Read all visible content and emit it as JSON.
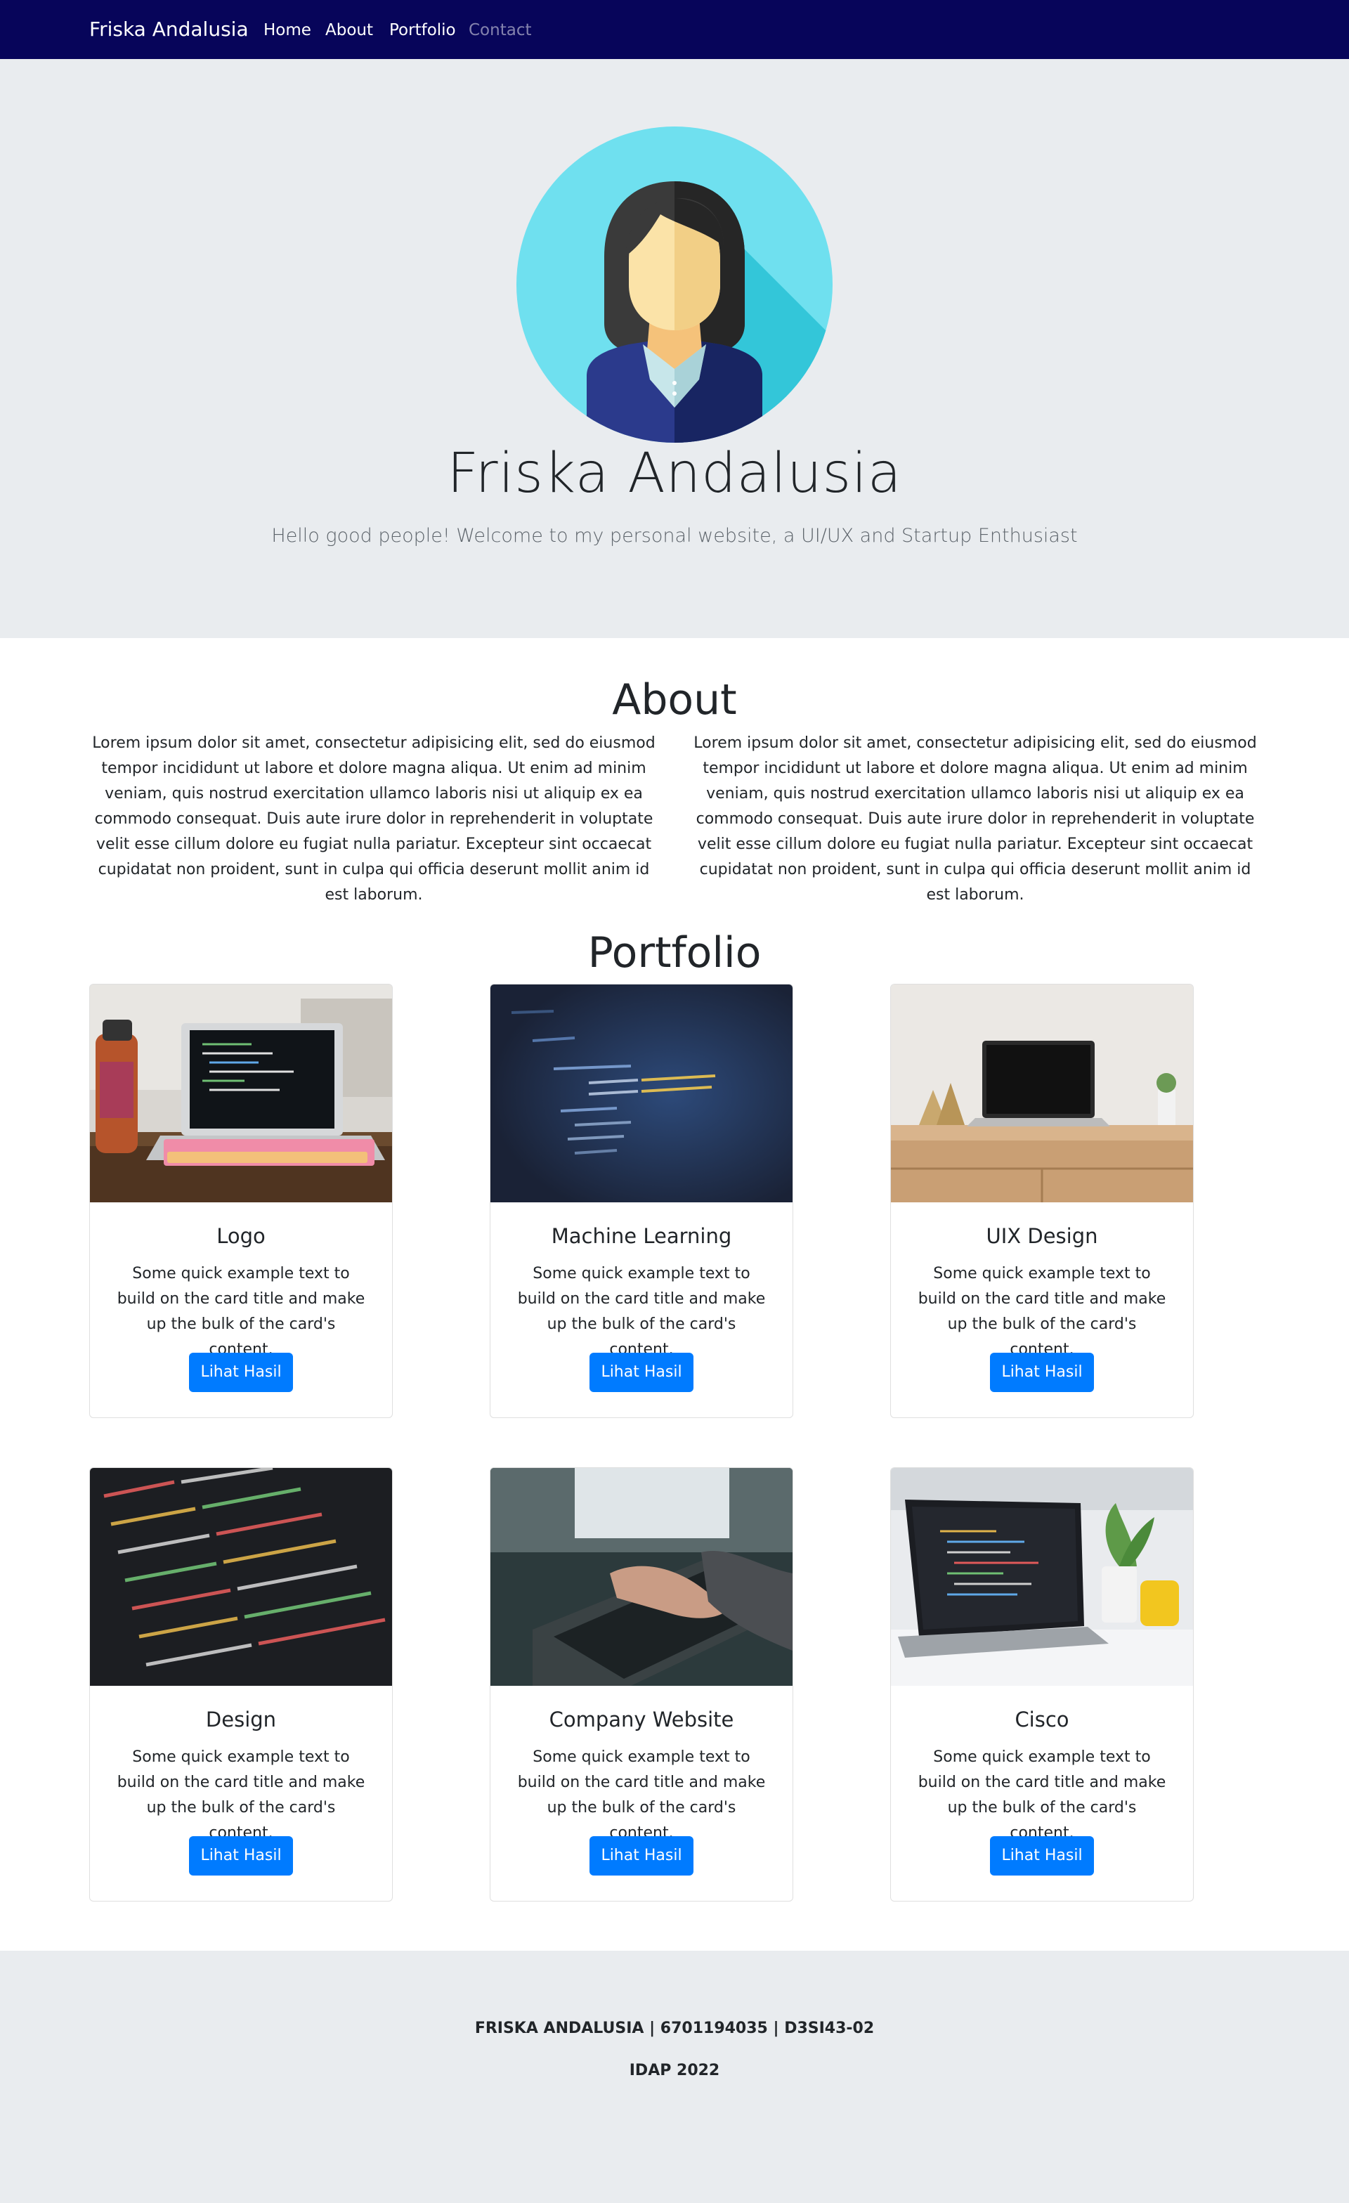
{
  "navbar": {
    "brand": "Friska Andalusia",
    "links": [
      "Home",
      "About",
      "Portfolio",
      "Contact"
    ]
  },
  "hero": {
    "avatar_icon": "woman-avatar-icon",
    "title": "Friska Andalusia",
    "subtitle": "Hello good people! Welcome to my personal website, a UI/UX and Startup Enthusiast"
  },
  "about": {
    "heading": "About",
    "paragraphs": [
      "Lorem ipsum dolor sit amet, consectetur adipisicing elit, sed do eiusmod tempor incididunt ut labore et dolore magna aliqua. Ut enim ad minim veniam, quis nostrud exercitation ullamco laboris nisi ut aliquip ex ea commodo consequat. Duis aute irure dolor in reprehenderit in voluptate velit esse cillum dolore eu fugiat nulla pariatur. Excepteur sint occaecat cupidatat non proident, sunt in culpa qui officia deserunt mollit anim id est laborum.",
      "Lorem ipsum dolor sit amet, consectetur adipisicing elit, sed do eiusmod tempor incididunt ut labore et dolore magna aliqua. Ut enim ad minim veniam, quis nostrud exercitation ullamco laboris nisi ut aliquip ex ea commodo consequat. Duis aute irure dolor in reprehenderit in voluptate velit esse cillum dolore eu fugiat nulla pariatur. Excepteur sint occaecat cupidatat non proident, sunt in culpa qui officia deserunt mollit anim id est laborum."
    ]
  },
  "portfolio": {
    "heading": "Portfolio",
    "cards": [
      {
        "title": "Logo",
        "text": "Some quick example text to build on the card title and make up the bulk of the card's content.",
        "button": "Lihat Hasil",
        "image": "laptop-desk-photo"
      },
      {
        "title": "Machine Learning",
        "text": "Some quick example text to build on the card title and make up the bulk of the card's content.",
        "button": "Lihat Hasil",
        "image": "code-screen-photo"
      },
      {
        "title": "UIX Design",
        "text": "Some quick example text to build on the card title and make up the bulk of the card's content.",
        "button": "Lihat Hasil",
        "image": "laptop-table-photo"
      },
      {
        "title": "Design",
        "text": "Some quick example text to build on the card title and make up the bulk of the card's content.",
        "button": "Lihat Hasil",
        "image": "code-closeup-photo"
      },
      {
        "title": "Company Website",
        "text": "Some quick example text to build on the card title and make up the bulk of the card's content.",
        "button": "Lihat Hasil",
        "image": "typing-hands-photo"
      },
      {
        "title": "Cisco",
        "text": "Some quick example text to build on the card title and make up the bulk of the card's content.",
        "button": "Lihat Hasil",
        "image": "macbook-plant-photo"
      }
    ]
  },
  "footer": {
    "line1": "FRISKA ANDALUSIA | 6701194035 | D3SI43-02",
    "line2": "IDAP 2022"
  },
  "colors": {
    "navbar": "#07055a",
    "hero_bg": "#e9ecef",
    "button": "#007bff"
  }
}
